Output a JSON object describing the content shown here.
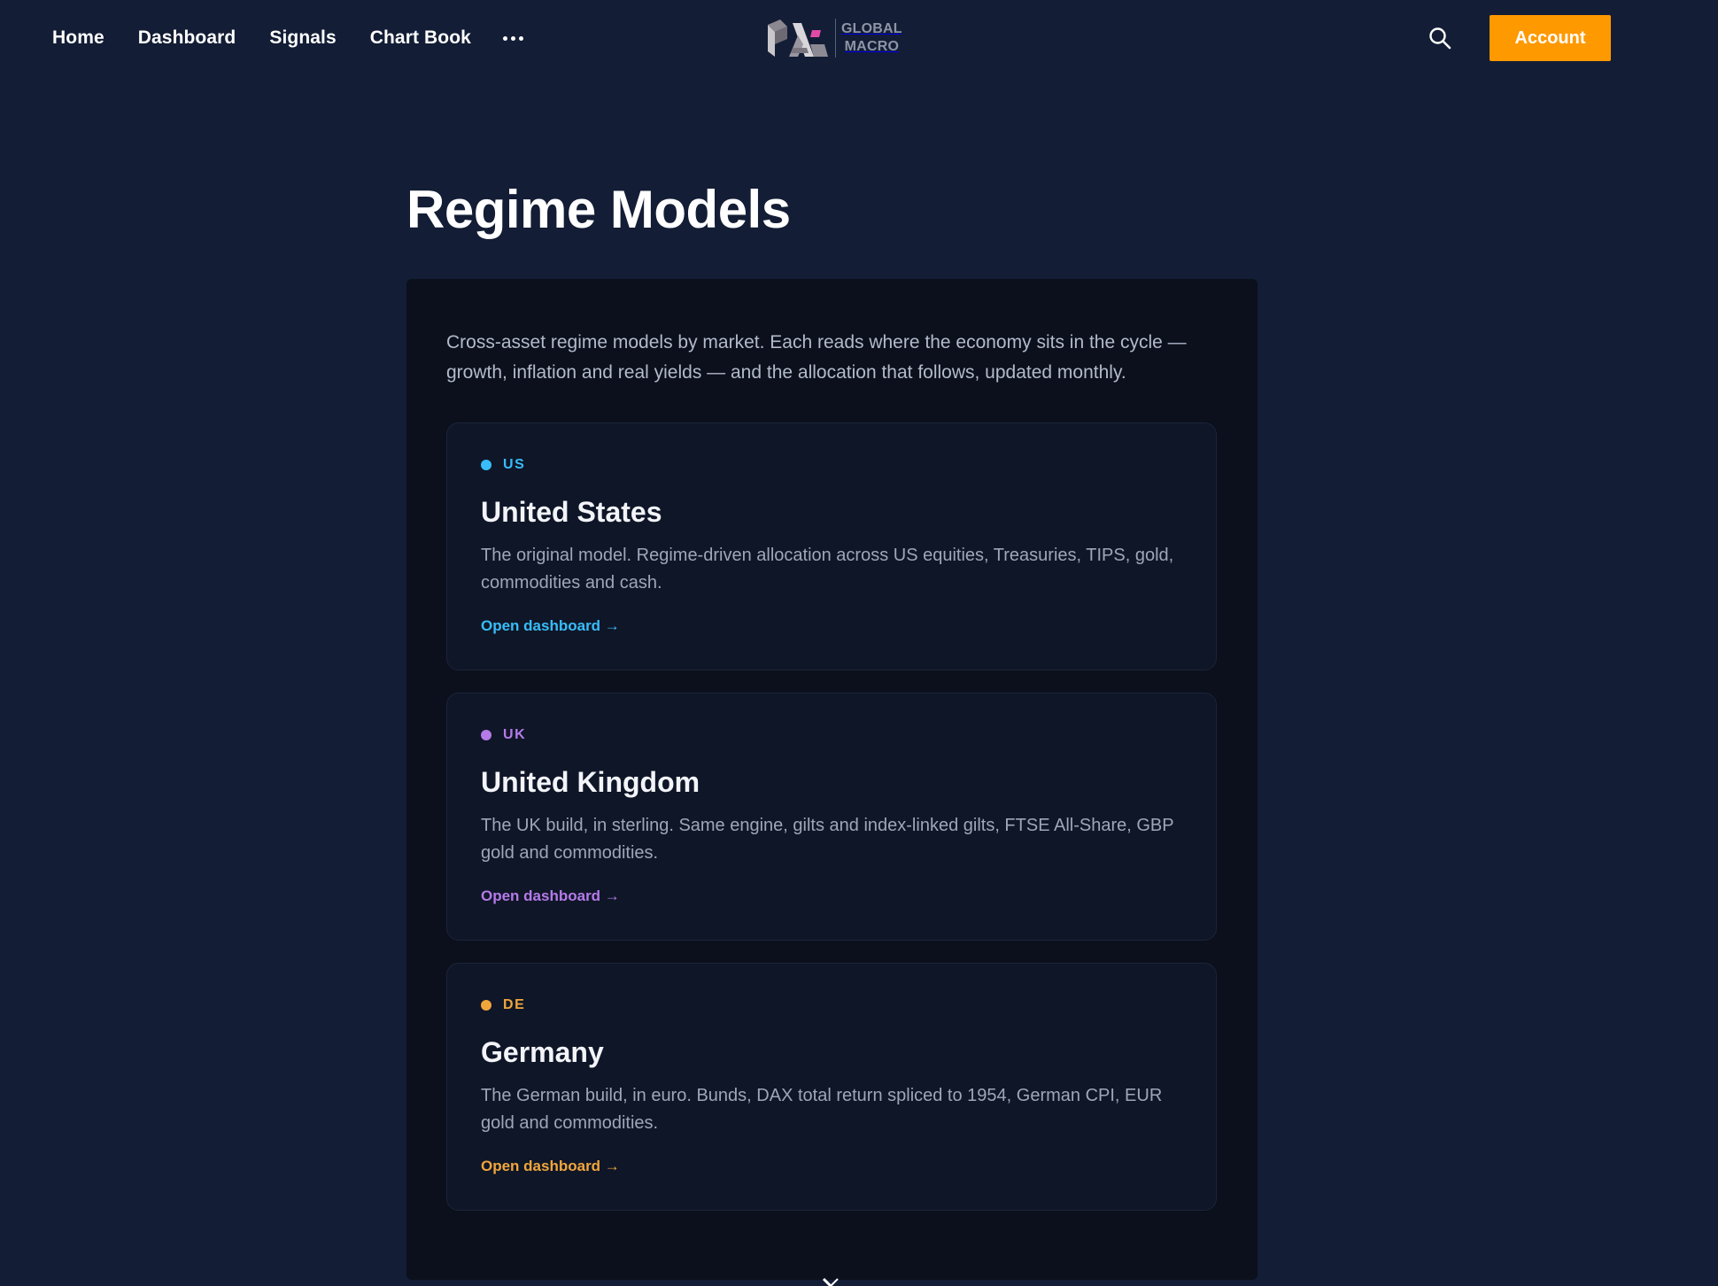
{
  "nav": {
    "links": [
      "Home",
      "Dashboard",
      "Signals",
      "Chart Book"
    ],
    "more_icon": "more-horizontal-icon",
    "search_icon": "search-icon",
    "account_label": "Account"
  },
  "brand": {
    "logo_icon": "pa-logo-icon",
    "line1": "GLOBAL",
    "line2": "MACRO"
  },
  "page": {
    "title": "Regime Models",
    "intro": "Cross-asset regime models by market. Each reads where the economy sits in the cycle — growth, inflation and real yields — and the allocation that follows, updated monthly."
  },
  "cards": [
    {
      "tag": "US",
      "title": "United States",
      "description": "The original model. Regime-driven allocation across US equities, Treasuries, TIPS, gold, commodities and cash.",
      "link": "Open dashboard →",
      "accent": "#38bdf8"
    },
    {
      "tag": "UK",
      "title": "United Kingdom",
      "description": "The UK build, in sterling. Same engine, gilts and index-linked gilts, FTSE All-Share, GBP gold and commodities.",
      "link": "Open dashboard →",
      "accent": "#b57be8"
    },
    {
      "tag": "DE",
      "title": "Germany",
      "description": "The German build, in euro. Bunds, DAX total return spliced to 1954, German CPI, EUR gold and commodities.",
      "link": "Open dashboard →",
      "accent": "#f0a63c"
    }
  ],
  "footer": {
    "social_icon": "x-logo-icon"
  },
  "colors": {
    "background": "#131d35",
    "panel": "#0b101c",
    "card": "#0f1628",
    "account_button": "#ff9900"
  }
}
